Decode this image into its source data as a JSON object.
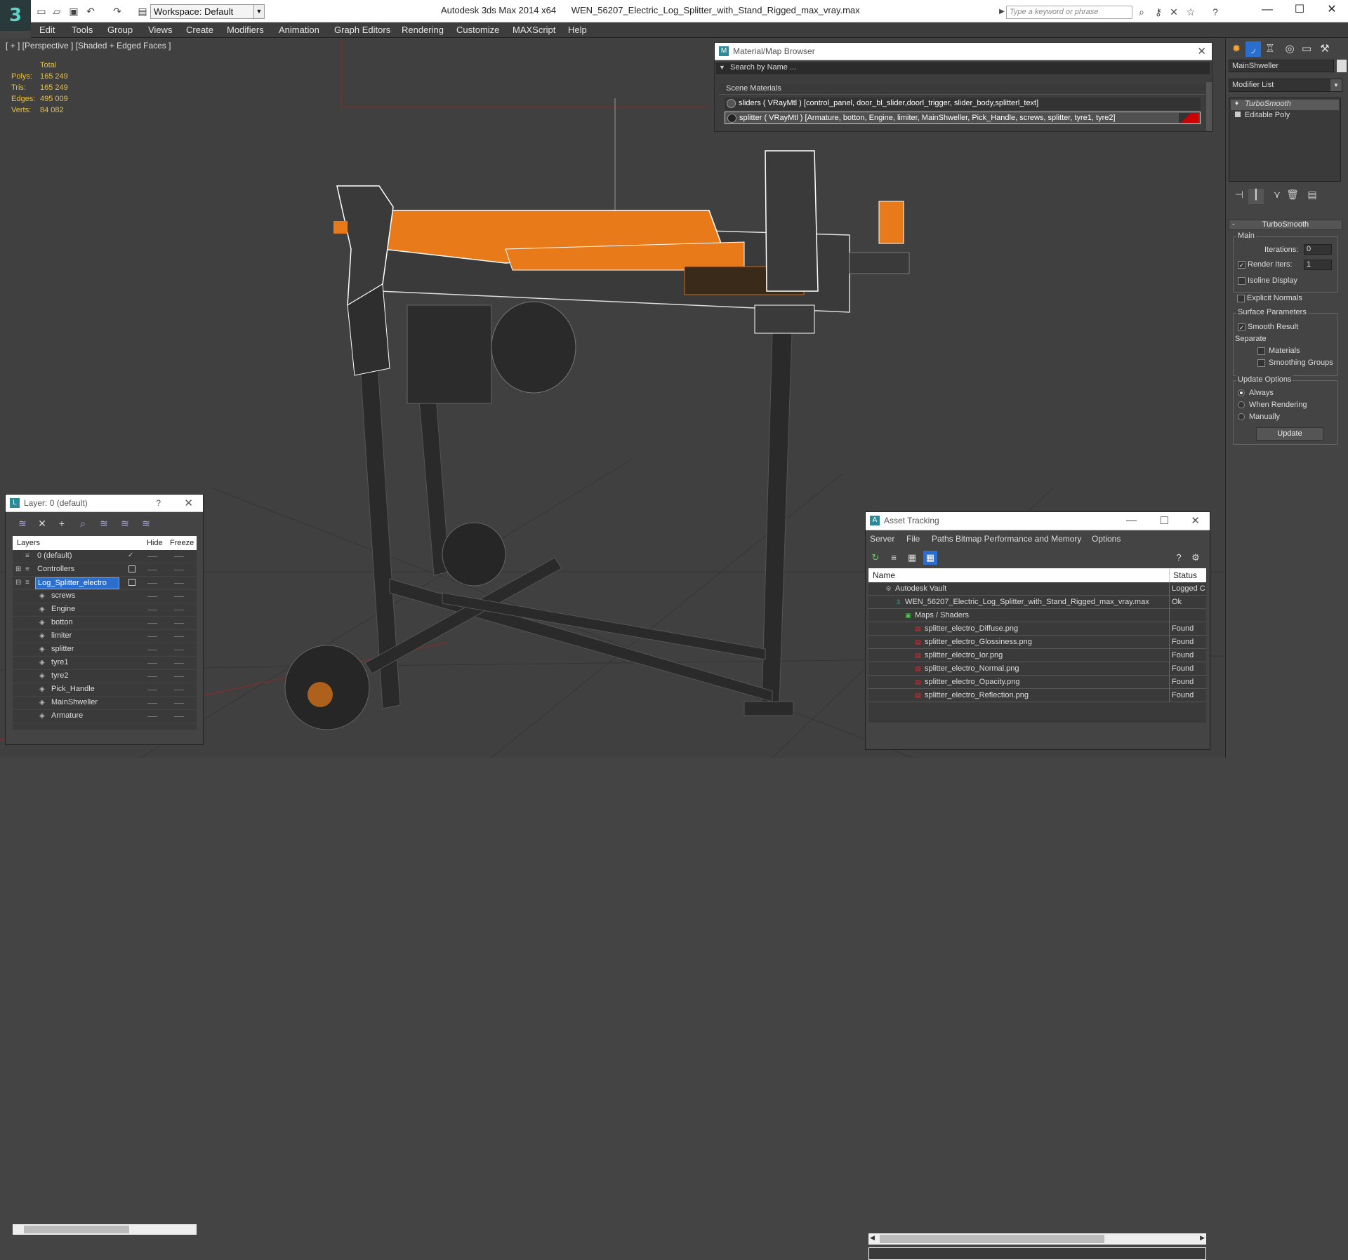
{
  "window": {
    "app_title": "Autodesk 3ds Max  2014 x64",
    "file_title": "WEN_56207_Electric_Log_Splitter_with_Stand_Rigged_max_vray.max",
    "workspace": "Workspace: Default",
    "search_placeholder": "Type a keyword or phrase"
  },
  "menu": [
    "Edit",
    "Tools",
    "Group",
    "Views",
    "Create",
    "Modifiers",
    "Animation",
    "Graph Editors",
    "Rendering",
    "Customize",
    "MAXScript",
    "Help"
  ],
  "viewport": {
    "label": "[ + ] [Perspective ] [Shaded + Edged Faces ]",
    "stats": {
      "header": "Total",
      "polys_label": "Polys:",
      "polys": "165 249",
      "tris_label": "Tris:",
      "tris": "165 249",
      "edges_label": "Edges:",
      "edges": "495 009",
      "verts_label": "Verts:",
      "verts": "84 082"
    },
    "colors": {
      "orange": "#e87a1a",
      "wire": "#ffffff",
      "frame": "#2a2a2a",
      "grid": "#353535"
    }
  },
  "material_browser": {
    "title": "Material/Map Browser",
    "search_placeholder": "Search by Name ...",
    "section": "Scene Materials",
    "rows": [
      "sliders ( VRayMtl ) [control_panel, door_bl_slider,doorl_trigger, slider_body,splitterl_text]",
      "splitter  ( VRayMtl )  [Armature, botton, Engine, limiter, MainShweller, Pick_Handle, screws, splitter, tyre1, tyre2]"
    ]
  },
  "command_panel": {
    "object_name": "MainShweller",
    "modifier_list": "Modifier List",
    "stack": [
      "TurboSmooth",
      "Editable Poly"
    ],
    "rollout_title": "TurboSmooth",
    "main_label": "Main",
    "iterations_label": "Iterations:",
    "iterations": "0",
    "render_iters_label": "Render Iters:",
    "render_iters": "1",
    "isoline": "Isoline Display",
    "explicit": "Explicit Normals",
    "surface_label": "Surface Parameters",
    "smooth_result": "Smooth Result",
    "separate_label": "Separate",
    "materials": "Materials",
    "smoothing_groups": "Smoothing Groups",
    "update_label": "Update Options",
    "always": "Always",
    "when_rendering": "When Rendering",
    "manually": "Manually",
    "update_button": "Update"
  },
  "layer_panel": {
    "title": "Layer: 0 (default)",
    "help": "?",
    "col_layers": "Layers",
    "col_hide": "Hide",
    "col_freeze": "Freeze",
    "rows": [
      {
        "name": "0 (default)",
        "indent": 0
      },
      {
        "name": "Controllers",
        "indent": 0
      },
      {
        "name": "Log_Splitter_electro",
        "indent": 0
      },
      {
        "name": "screws",
        "indent": 1
      },
      {
        "name": "Engine",
        "indent": 1
      },
      {
        "name": "botton",
        "indent": 1
      },
      {
        "name": "limiter",
        "indent": 1
      },
      {
        "name": "splitter",
        "indent": 1
      },
      {
        "name": "tyre1",
        "indent": 1
      },
      {
        "name": "tyre2",
        "indent": 1
      },
      {
        "name": "Pick_Handle",
        "indent": 1
      },
      {
        "name": "MainShweller",
        "indent": 1
      },
      {
        "name": "Armature",
        "indent": 1
      }
    ]
  },
  "asset_tracking": {
    "title": "Asset Tracking",
    "menu": [
      "Server",
      "File",
      "Paths",
      "Bitmap Performance and Memory",
      "Options"
    ],
    "col_name": "Name",
    "col_status": "Status",
    "rows": [
      {
        "name": "Autodesk Vault",
        "status": "Logged C",
        "indent": 1
      },
      {
        "name": "WEN_56207_Electric_Log_Splitter_with_Stand_Rigged_max_vray.max",
        "status": "Ok",
        "indent": 2
      },
      {
        "name": "Maps / Shaders",
        "status": "",
        "indent": 3
      },
      {
        "name": "splitter_electro_Diffuse.png",
        "status": "Found",
        "indent": 4
      },
      {
        "name": "splitter_electro_Glossiness.png",
        "status": "Found",
        "indent": 4
      },
      {
        "name": "splitter_electro_Ior.png",
        "status": "Found",
        "indent": 4
      },
      {
        "name": "splitter_electro_Normal.png",
        "status": "Found",
        "indent": 4
      },
      {
        "name": "splitter_electro_Opacity.png",
        "status": "Found",
        "indent": 4
      },
      {
        "name": "splitter_electro_Reflection.png",
        "status": "Found",
        "indent": 4
      }
    ]
  }
}
